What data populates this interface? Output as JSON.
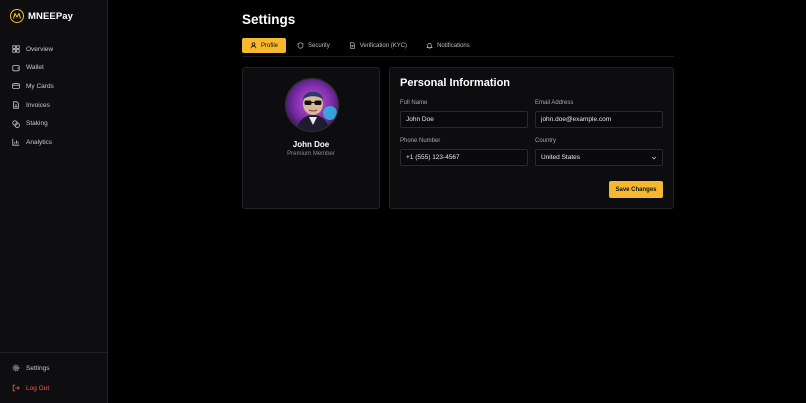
{
  "app": {
    "name": "MNEEPay",
    "logo_icon": "mnee-logo-icon",
    "accent_color": "#f5b82e"
  },
  "sidebar": {
    "items": [
      {
        "label": "Overview",
        "icon": "grid-icon"
      },
      {
        "label": "Wallet",
        "icon": "wallet-icon"
      },
      {
        "label": "My Cards",
        "icon": "credit-card-icon"
      },
      {
        "label": "Invoices",
        "icon": "file-icon"
      },
      {
        "label": "Staking",
        "icon": "coins-icon"
      },
      {
        "label": "Analytics",
        "icon": "bar-chart-icon"
      }
    ],
    "bottom": [
      {
        "label": "Settings",
        "icon": "gear-icon"
      },
      {
        "label": "Log Out",
        "icon": "logout-icon",
        "color": "#ef5a52"
      }
    ]
  },
  "page": {
    "title": "Settings"
  },
  "tabs": [
    {
      "label": "Profile",
      "icon": "user-icon",
      "active": true
    },
    {
      "label": "Security",
      "icon": "shield-icon",
      "active": false
    },
    {
      "label": "Verification (KYC)",
      "icon": "document-icon",
      "active": false
    },
    {
      "label": "Notifications",
      "icon": "bell-icon",
      "active": false
    }
  ],
  "profile": {
    "name": "John Doe",
    "role": "Premium Member",
    "avatar": "avatar-image"
  },
  "personal_info": {
    "title": "Personal Information",
    "full_name": {
      "label": "Full Name",
      "value": "John Doe"
    },
    "email": {
      "label": "Email Address",
      "value": "john.doe@example.com"
    },
    "phone": {
      "label": "Phone Number",
      "value": "+1 (555) 123-4567"
    },
    "country": {
      "label": "Country",
      "value": "United States"
    },
    "save_label": "Save Changes"
  }
}
